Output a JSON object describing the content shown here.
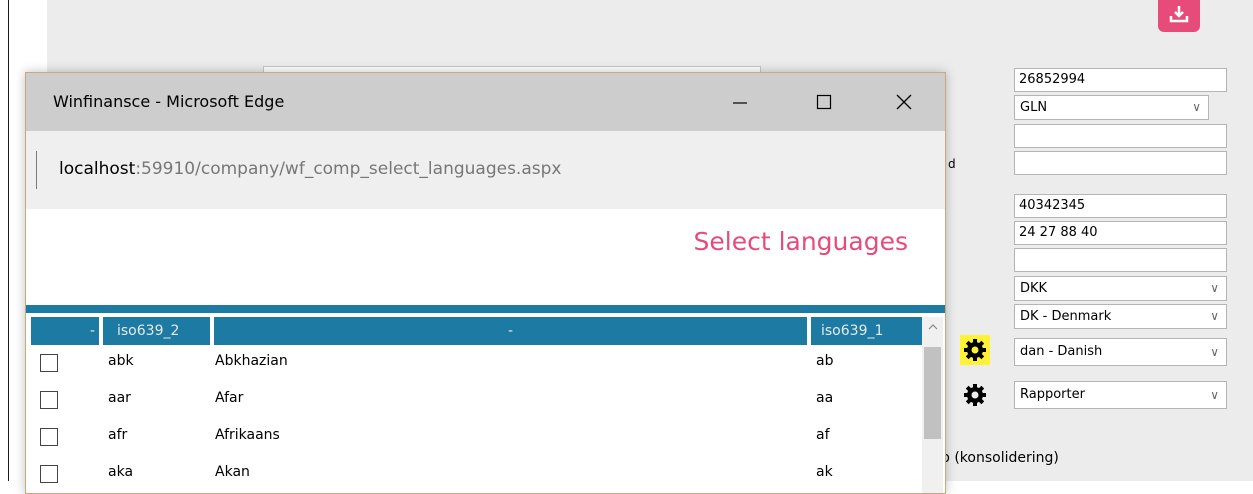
{
  "window": {
    "title": "Winfinansce - Microsoft Edge",
    "url_host": "localhost",
    "url_path": ":59910/company/wf_comp_select_languages.aspx",
    "accent_color": "#e64b7a",
    "table_header_color": "#1c7aa3"
  },
  "dialog": {
    "heading": "Select languages",
    "columns": [
      "-",
      "iso639_2",
      "-",
      "iso639_1"
    ],
    "rows": [
      {
        "iso639_2": "abk",
        "name": "Abkhazian",
        "iso639_1": "ab"
      },
      {
        "iso639_2": "aar",
        "name": "Afar",
        "iso639_1": "aa"
      },
      {
        "iso639_2": "afr",
        "name": "Afrikaans",
        "iso639_1": "af"
      },
      {
        "iso639_2": "aka",
        "name": "Akan",
        "iso639_1": "ak"
      }
    ]
  },
  "form": {
    "field_number": "26852994",
    "id_type_select": "GLN",
    "field_empty_1": "",
    "field_empty_2": "",
    "phone_1": "40342345",
    "phone_2": "24 27 88 40",
    "field_empty_3": "",
    "currency_select": "DKK",
    "country_select": "DK - Denmark",
    "language_select": "dan - Danish",
    "report_select": "Rapporter",
    "consolidation_text": "p (konsolidering)",
    "fragment_char": "d"
  },
  "icons": {
    "download": "download-icon",
    "gear": "gear-icon",
    "minimize": "minimize-icon",
    "maximize": "maximize-icon",
    "close": "close-icon",
    "chevron": "chevron-down-icon",
    "scroll_up": "scroll-up-icon"
  }
}
